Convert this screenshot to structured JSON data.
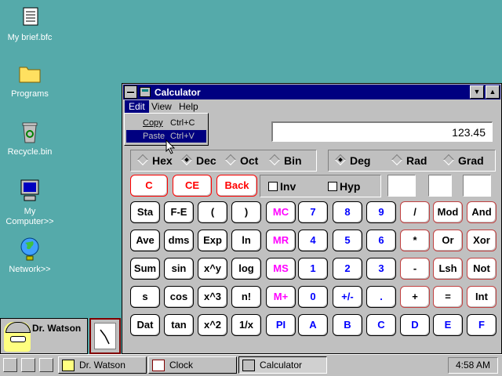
{
  "desktop": {
    "icons": [
      {
        "label": "My brief.bfc",
        "icon": "briefcase-doc-icon"
      },
      {
        "label": "Programs",
        "icon": "folder-icon"
      },
      {
        "label": "Recycle.bin",
        "icon": "recycle-bin-icon"
      },
      {
        "label": "My Computer>>",
        "icon": "computer-icon"
      },
      {
        "label": "Network>>",
        "icon": "globe-icon"
      }
    ]
  },
  "calculator": {
    "title": "Calculator",
    "menu": [
      "Edit",
      "View",
      "Help"
    ],
    "edit_menu": [
      {
        "label": "Copy",
        "shortcut": "Ctrl+C"
      },
      {
        "label": "Paste",
        "shortcut": "Ctrl+V"
      }
    ],
    "display": "123.45",
    "number_base": [
      "Hex",
      "Dec",
      "Oct",
      "Bin"
    ],
    "selected_base": "Dec",
    "angle_units": [
      "Deg",
      "Rad",
      "Grad"
    ],
    "selected_angle": "Deg",
    "checks": [
      "Inv",
      "Hyp"
    ],
    "top_buttons": [
      "C",
      "CE",
      "Back"
    ],
    "rows": [
      [
        "Sta",
        "F-E",
        "(",
        ")",
        "MC",
        "7",
        "8",
        "9",
        "/",
        "Mod",
        "And"
      ],
      [
        "Ave",
        "dms",
        "Exp",
        "ln",
        "MR",
        "4",
        "5",
        "6",
        "*",
        "Or",
        "Xor"
      ],
      [
        "Sum",
        "sin",
        "x^y",
        "log",
        "MS",
        "1",
        "2",
        "3",
        "-",
        "Lsh",
        "Not"
      ],
      [
        "s",
        "cos",
        "x^3",
        "n!",
        "M+",
        "0",
        "+/-",
        ".",
        "+",
        "=",
        "Int"
      ],
      [
        "Dat",
        "tan",
        "x^2",
        "1/x",
        "PI",
        "A",
        "B",
        "C",
        "D",
        "E",
        "F"
      ]
    ]
  },
  "watson": {
    "name": "Dr. Watson"
  },
  "taskbar": {
    "tasks": [
      {
        "label": "Dr. Watson"
      },
      {
        "label": "Clock"
      },
      {
        "label": "Calculator"
      }
    ],
    "time": "4:58 AM"
  }
}
